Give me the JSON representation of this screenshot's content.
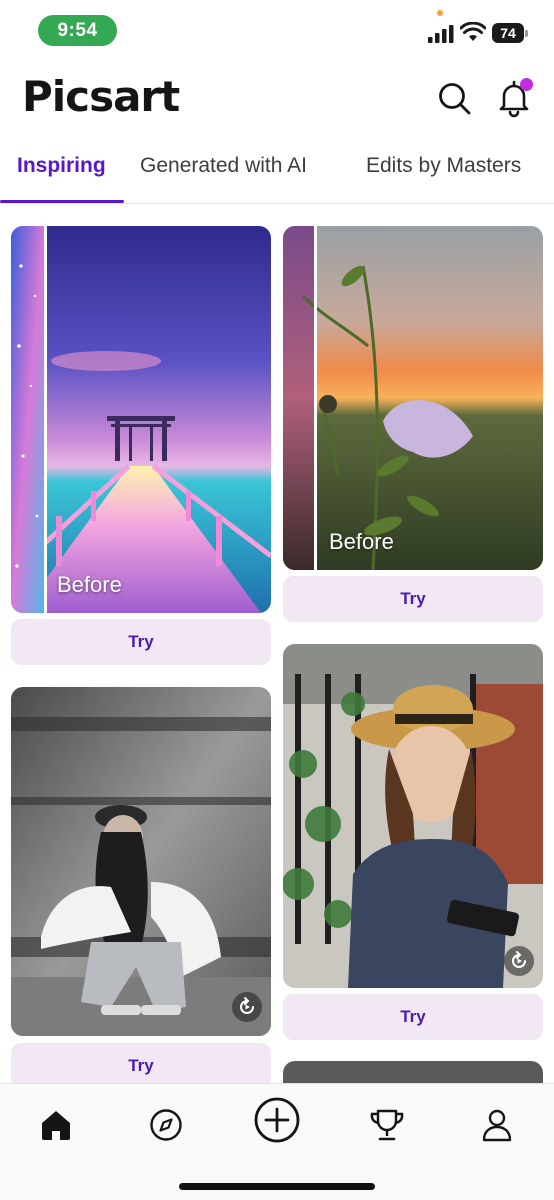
{
  "status_bar": {
    "time": "9:54",
    "battery": "74",
    "icons": [
      "signal-icon",
      "wifi-icon",
      "battery-icon"
    ]
  },
  "header": {
    "logo": "Picsart",
    "search_icon": "search-icon",
    "notifications_icon": "bell-icon"
  },
  "tabs": [
    {
      "label": "Inspiring",
      "active": true
    },
    {
      "label": "Generated with AI",
      "active": false
    },
    {
      "label": "Edits by Masters",
      "active": false
    }
  ],
  "feed": {
    "cards": [
      {
        "id": "pier",
        "before_label": "Before",
        "button": "Try"
      },
      {
        "id": "flower",
        "before_label": "Before",
        "button": "Try"
      },
      {
        "id": "motion-portrait",
        "button": "Try",
        "icon": "replay-icon"
      },
      {
        "id": "hat-portrait",
        "button": "Try",
        "icon": "replay-icon"
      }
    ]
  },
  "bottom_nav": {
    "items": [
      "home-icon",
      "compass-icon",
      "add-icon",
      "trophy-icon",
      "profile-icon"
    ]
  },
  "colors": {
    "accent": "#5a17c9",
    "try_bg": "#f1e8f3",
    "notification_dot": "#c02ee0",
    "time_pill": "#34a853"
  }
}
